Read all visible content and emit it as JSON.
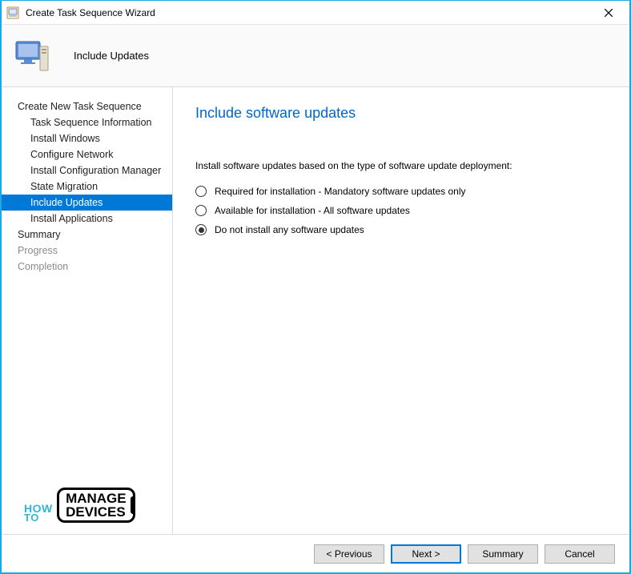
{
  "window": {
    "title": "Create Task Sequence Wizard"
  },
  "header": {
    "page_name": "Include Updates"
  },
  "sidebar": {
    "items": [
      {
        "label": "Create New Task Sequence",
        "level": 0,
        "selected": false,
        "disabled": false
      },
      {
        "label": "Task Sequence Information",
        "level": 1,
        "selected": false,
        "disabled": false
      },
      {
        "label": "Install Windows",
        "level": 1,
        "selected": false,
        "disabled": false
      },
      {
        "label": "Configure Network",
        "level": 1,
        "selected": false,
        "disabled": false
      },
      {
        "label": "Install Configuration Manager",
        "level": 1,
        "selected": false,
        "disabled": false
      },
      {
        "label": "State Migration",
        "level": 1,
        "selected": false,
        "disabled": false
      },
      {
        "label": "Include Updates",
        "level": 1,
        "selected": true,
        "disabled": false
      },
      {
        "label": "Install Applications",
        "level": 1,
        "selected": false,
        "disabled": false
      },
      {
        "label": "Summary",
        "level": 0,
        "selected": false,
        "disabled": false
      },
      {
        "label": "Progress",
        "level": 0,
        "selected": false,
        "disabled": true
      },
      {
        "label": "Completion",
        "level": 0,
        "selected": false,
        "disabled": true
      }
    ]
  },
  "content": {
    "heading": "Include software updates",
    "intro": "Install software updates based on the type of software update deployment:",
    "options": [
      {
        "label": "Required for installation - Mandatory software updates only",
        "checked": false
      },
      {
        "label": "Available for installation - All software updates",
        "checked": false
      },
      {
        "label": "Do not install any software updates",
        "checked": true
      }
    ]
  },
  "footer": {
    "previous": "< Previous",
    "next": "Next >",
    "summary": "Summary",
    "cancel": "Cancel"
  },
  "logo": {
    "how": "HOW",
    "to": "TO",
    "manage": "MANAGE",
    "devices": "DEVICES"
  }
}
